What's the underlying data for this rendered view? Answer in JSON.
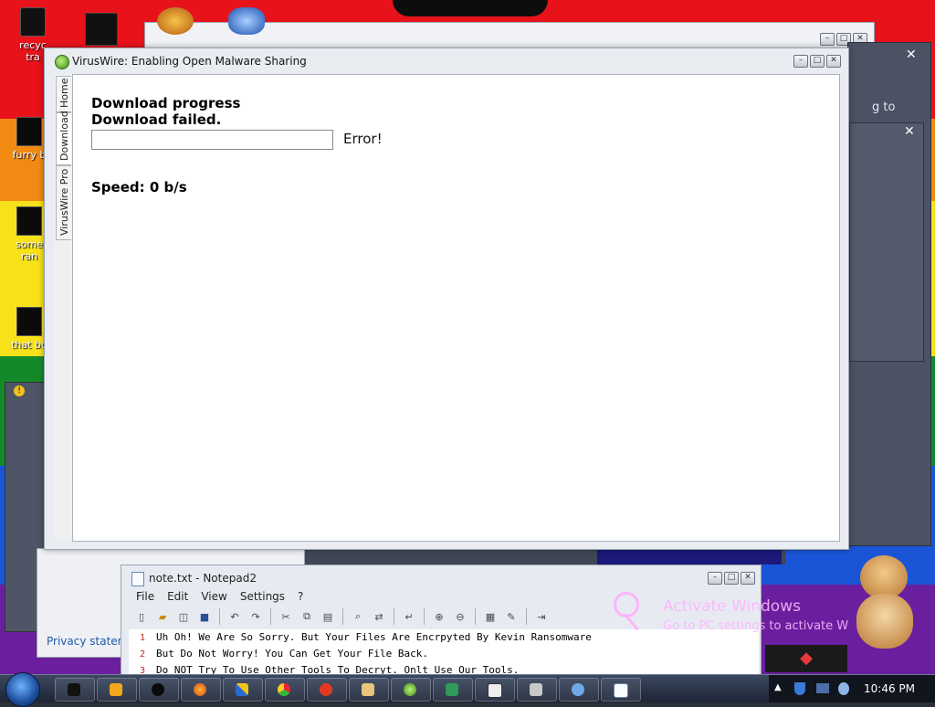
{
  "desktop": {
    "icons": [
      {
        "label": "recyc\ntra"
      },
      {
        "label": "furry b"
      },
      {
        "label": "some\nran"
      },
      {
        "label": "that bu"
      }
    ],
    "bg_text": "g to",
    "privacy_text": "Privacy stateme"
  },
  "main_window": {
    "title": "VirusWire: Enabling Open Malware Sharing",
    "tabs": [
      "Home",
      "Download",
      "VirusWire Pro"
    ],
    "active_tab": "Download",
    "progress_heading": "Download progress",
    "status_text": "Download failed.",
    "progress_value": 0,
    "error_text": "Error!",
    "speed_text": "Speed: 0 b/s"
  },
  "notepad": {
    "title": "note.txt - Notepad2",
    "menu": [
      "File",
      "Edit",
      "View",
      "Settings",
      "?"
    ],
    "lines": [
      {
        "num": "1",
        "text": "Uh Oh! We Are So Sorry. But Your Files Are Encrpyted By Kevin Ransomware"
      },
      {
        "num": "2",
        "text": "But Do Not Worry! You Can Get Your File Back."
      },
      {
        "num": "3",
        "text": "Do NOT Try To Use Other Tools To Decryt. Onlt Use Our Tools."
      }
    ]
  },
  "watermark": {
    "line1": "Activate Windows",
    "line2": "Go to PC settings to activate W"
  },
  "taskbar": {
    "clock": "10:46 PM"
  },
  "colors": {
    "wallpaper_red": "#e8121b",
    "wallpaper_yellow": "#f7e21a",
    "wallpaper_green": "#138a2a",
    "wallpaper_blue": "#1a55d8"
  }
}
